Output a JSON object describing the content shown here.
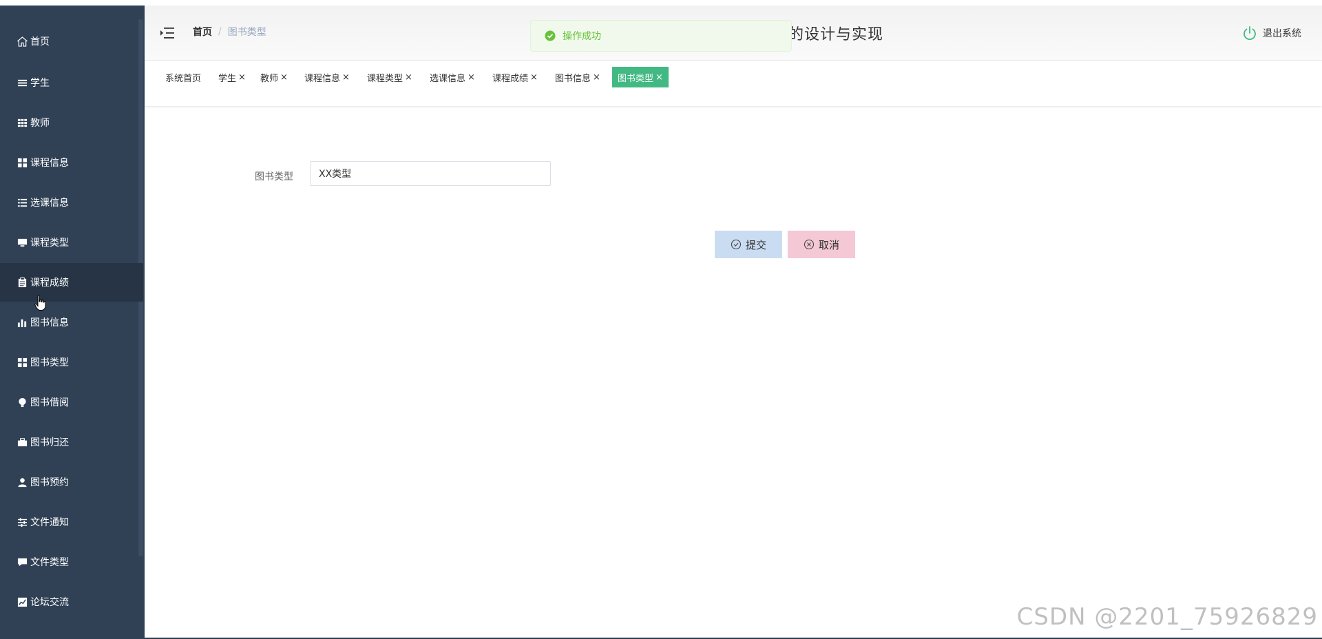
{
  "sidebar": {
    "items": [
      {
        "label": "首页",
        "icon": "home-icon"
      },
      {
        "label": "学生",
        "icon": "list-icon"
      },
      {
        "label": "教师",
        "icon": "grid-icon"
      },
      {
        "label": "课程信息",
        "icon": "tiles-icon"
      },
      {
        "label": "选课信息",
        "icon": "list-check-icon"
      },
      {
        "label": "课程类型",
        "icon": "monitor-icon"
      },
      {
        "label": "课程成绩",
        "icon": "clipboard-icon"
      },
      {
        "label": "图书信息",
        "icon": "bar-chart-icon"
      },
      {
        "label": "图书类型",
        "icon": "tiles-icon"
      },
      {
        "label": "图书借阅",
        "icon": "bulb-icon"
      },
      {
        "label": "图书归还",
        "icon": "briefcase-icon"
      },
      {
        "label": "图书预约",
        "icon": "user-icon"
      },
      {
        "label": "文件通知",
        "icon": "sliders-icon"
      },
      {
        "label": "文件类型",
        "icon": "chat-icon"
      },
      {
        "label": "论坛交流",
        "icon": "chart-icon"
      }
    ]
  },
  "header": {
    "breadcrumb_home": "首页",
    "breadcrumb_separator": "/",
    "breadcrumb_current": "图书类型",
    "title_visible": "的设计与实现",
    "logout_label": "退出系统"
  },
  "toast": {
    "message": "操作成功",
    "color": "#67c23a"
  },
  "tags": [
    {
      "label": "系统首页",
      "closable": false,
      "active": false
    },
    {
      "label": "学生",
      "closable": true,
      "active": false
    },
    {
      "label": "教师",
      "closable": true,
      "active": false
    },
    {
      "label": "课程信息",
      "closable": true,
      "active": false
    },
    {
      "label": "课程类型",
      "closable": true,
      "active": false
    },
    {
      "label": "选课信息",
      "closable": true,
      "active": false
    },
    {
      "label": "课程成绩",
      "closable": true,
      "active": false
    },
    {
      "label": "图书信息",
      "closable": true,
      "active": false
    },
    {
      "label": "图书类型",
      "closable": true,
      "active": true
    }
  ],
  "tag_close_symbol": "×",
  "form": {
    "label": "图书类型",
    "value": "XX类型"
  },
  "buttons": {
    "submit_label": "提交",
    "cancel_label": "取消"
  },
  "watermark": "CSDN @2201_75926829",
  "colors": {
    "sidebar_bg": "#304156",
    "active_tag": "#42b983",
    "submit_bg": "#c9dcf2",
    "cancel_bg": "#f5c8d5"
  }
}
